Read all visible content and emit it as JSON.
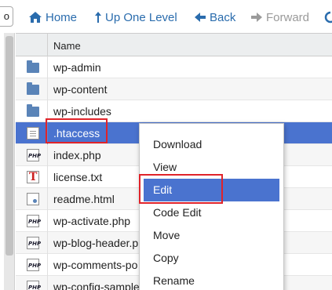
{
  "toolbar": {
    "partial_label": "o",
    "home_label": "Home",
    "up_label": "Up One Level",
    "back_label": "Back",
    "forward_label": "Forward"
  },
  "table": {
    "column_name": "Name",
    "rows": [
      {
        "name": "wp-admin",
        "icon": "folder-icon"
      },
      {
        "name": "wp-content",
        "icon": "folder-icon"
      },
      {
        "name": "wp-includes",
        "icon": "folder-icon"
      },
      {
        "name": ".htaccess",
        "icon": "generic-file-icon"
      },
      {
        "name": "index.php",
        "icon": "php-file-icon"
      },
      {
        "name": "license.txt",
        "icon": "text-file-icon"
      },
      {
        "name": "readme.html",
        "icon": "html-file-icon"
      },
      {
        "name": "wp-activate.php",
        "icon": "php-file-icon"
      },
      {
        "name": "wp-blog-header.p",
        "icon": "php-file-icon"
      },
      {
        "name": "wp-comments-po",
        "icon": "php-file-icon"
      },
      {
        "name": "wp-config-sample",
        "icon": "php-file-icon"
      }
    ]
  },
  "context_menu": {
    "items": [
      "Download",
      "View",
      "Edit",
      "Code Edit",
      "Move",
      "Copy",
      "Rename"
    ]
  },
  "colors": {
    "accent": "#2a6cad",
    "selection": "#4a73cf",
    "highlight_box": "#e0232a"
  }
}
